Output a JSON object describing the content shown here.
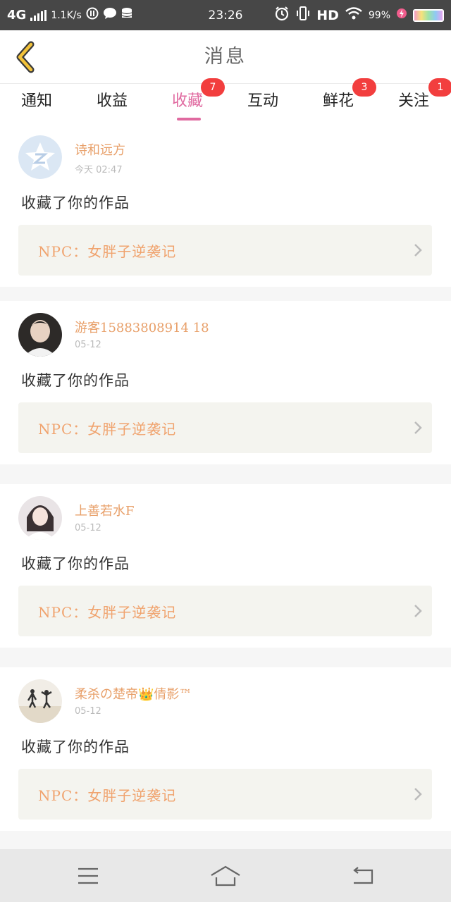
{
  "status_bar": {
    "network": "4G",
    "speed": "1.1K/s",
    "time": "23:26",
    "hd": "HD",
    "battery_pct": "99%",
    "battery_level": 0.99
  },
  "header": {
    "title": "消息",
    "back_icon": "chevron-left-icon",
    "accent_color": "#f2c23a"
  },
  "tabs": [
    {
      "label": "通知",
      "badge": ""
    },
    {
      "label": "收益",
      "badge": ""
    },
    {
      "label": "收藏",
      "badge": "7",
      "active": true
    },
    {
      "label": "互动",
      "badge": ""
    },
    {
      "label": "鲜花",
      "badge": "3"
    },
    {
      "label": "关注",
      "badge": "1"
    }
  ],
  "messages": [
    {
      "user": "诗和远方",
      "time": "今天 02:47",
      "action": "收藏了你的作品",
      "work": "NPC：女胖子逆袭记"
    },
    {
      "user": "游客15883808914 18",
      "time": "05-12",
      "action": "收藏了你的作品",
      "work": "NPC：女胖子逆袭记"
    },
    {
      "user": "上善若水F",
      "time": "05-12",
      "action": "收藏了你的作品",
      "work": "NPC：女胖子逆袭记"
    },
    {
      "user": "柔杀の楚帝👑倩影™",
      "time": "05-12",
      "action": "收藏了你的作品",
      "work": "NPC：女胖子逆袭记"
    }
  ],
  "colors": {
    "active_tab": "#e06aa0",
    "badge": "#f23e3e",
    "username": "#e8a06a",
    "work_title": "#f0a36e"
  },
  "nav": {
    "menu_icon": "menu-icon",
    "home_icon": "home-icon",
    "back_icon": "back-icon"
  }
}
